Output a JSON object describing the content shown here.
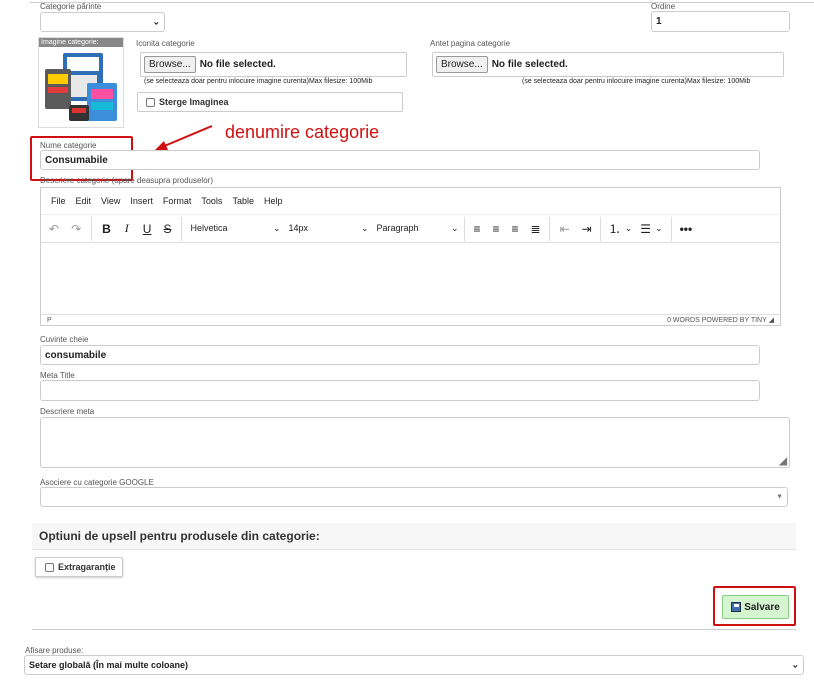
{
  "form": {
    "parent_category_label": "Categorie părinte",
    "order_label": "Ordine",
    "order_value": "1",
    "image_label": "Imagine categorie:",
    "icon_label": "Iconita categorie",
    "header_label": "Antet pagina categorie",
    "browse_label": "Browse...",
    "no_file_label": "No file selected.",
    "file_hint": "(se selecteaza doar pentru inlocuire imagine curenta)Max filesize: 100Mib",
    "delete_image_label": "Sterge Imaginea",
    "annotation": "denumire categorie",
    "name_label": "Nume categorie",
    "name_value": "Consumabile",
    "description_label": "Descriere categorie (apare deasupra produselor)",
    "keywords_label": "Cuvinte cheie",
    "keywords_value": "consumabile",
    "meta_title_label": "Meta Title",
    "meta_title_value": "",
    "meta_description_label": "Descriere meta",
    "google_label": "Asociere cu categorie GOOGLE",
    "upsell_title": "Optiuni de upsell pentru produsele din categorie:",
    "extra_warranty_label": "Extragaranție",
    "save_label": "Salvare",
    "display_label": "Afisare produse:",
    "display_value": "Setare globală (În mai multe coloane)"
  },
  "editor": {
    "menu": [
      "File",
      "Edit",
      "View",
      "Insert",
      "Format",
      "Tools",
      "Table",
      "Help"
    ],
    "font_family": "Helvetica",
    "font_size": "14px",
    "block_format": "Paragraph",
    "status_path": "P",
    "status_words": "0 WORDS",
    "status_powered": "POWERED BY TINY"
  },
  "colors": {
    "annotation_red": "#d01010",
    "save_green": "#d5f5d0"
  }
}
